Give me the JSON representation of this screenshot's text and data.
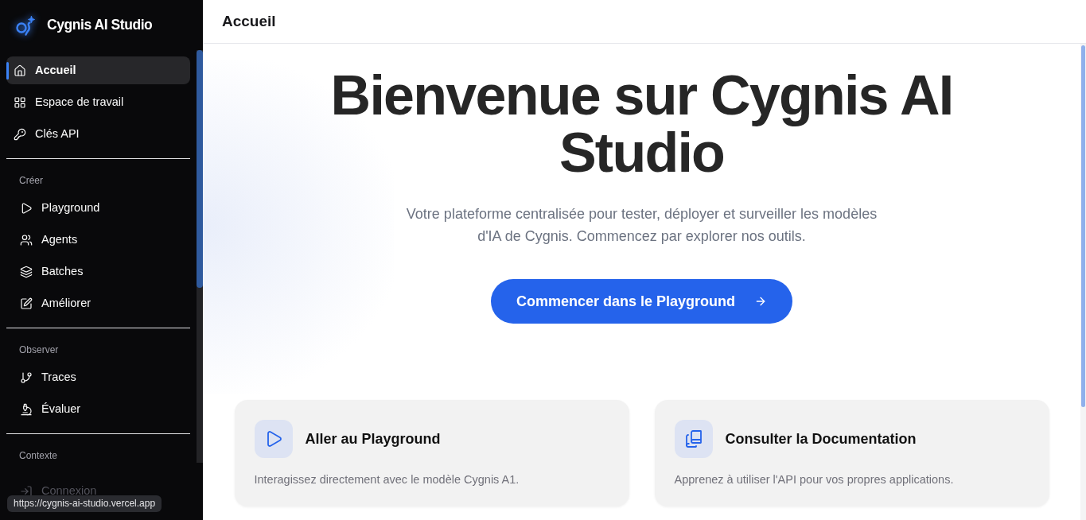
{
  "sidebar": {
    "brand": "Cygnis AI Studio",
    "items": [
      {
        "label": "Accueil",
        "selected": true,
        "disabled": false
      },
      {
        "label": "Espace de travail",
        "selected": false,
        "disabled": false
      },
      {
        "label": "Clés API",
        "selected": false,
        "disabled": false
      }
    ],
    "sections": [
      {
        "title": "Créer",
        "items": [
          {
            "label": "Playground",
            "selected": false,
            "disabled": false
          },
          {
            "label": "Agents",
            "selected": false,
            "disabled": false
          },
          {
            "label": "Batches",
            "selected": false,
            "disabled": false
          },
          {
            "label": "Améliorer",
            "selected": false,
            "disabled": false
          }
        ]
      },
      {
        "title": "Observer",
        "items": [
          {
            "label": "Traces",
            "selected": false,
            "disabled": false
          },
          {
            "label": "Évaluer",
            "selected": false,
            "disabled": false
          }
        ]
      },
      {
        "title": "Contexte",
        "items": [
          {
            "label": "Connexion",
            "selected": false,
            "disabled": true
          }
        ]
      }
    ]
  },
  "header": {
    "title": "Accueil"
  },
  "hero": {
    "title": "Bienvenue sur Cygnis AI Studio",
    "subtitle": "Votre plateforme centralisée pour tester, déployer et surveiller les modèles d'IA de Cygnis. Commencez par explorer nos outils.",
    "button": "Commencer dans le Playground"
  },
  "cards": [
    {
      "title": "Aller au Playground",
      "description": "Interagissez directement avec le modèle Cygnis A1."
    },
    {
      "title": "Consulter la Documentation",
      "description": "Apprenez à utiliser l'API pour vos propres applications."
    }
  ],
  "link_preview": {
    "url": "https://cygnis-ai-studio.vercel.app"
  }
}
